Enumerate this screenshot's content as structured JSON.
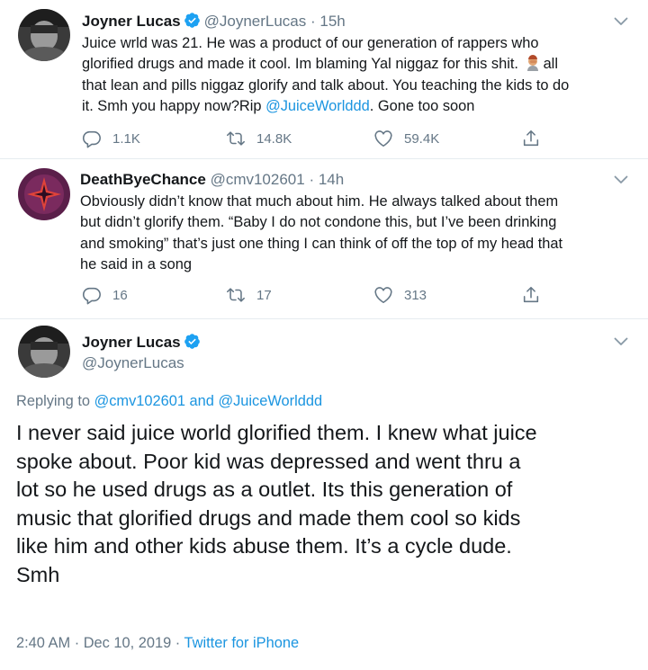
{
  "colors": {
    "link": "#1b95e0",
    "muted": "#657786",
    "text": "#14171a",
    "verified": "#1da1f2"
  },
  "tweet1": {
    "name": "Joyner Lucas",
    "handle": "@JoynerLucas",
    "time": "· 15h",
    "lines": [
      "Juice wrld was 21. He was a product of our generation of rappers who",
      "glorified drugs and made it cool. Im blaming Yal niggaz for this shit.",
      "all",
      "that lean and pills niggaz glorify and talk about. You teaching the kids to do",
      "it. Smh you happy now?Rip",
      "@JuiceWorlddd",
      ". Gone too soon"
    ],
    "emoji": "facepalm-emoji",
    "replies": "1.1K",
    "retweets": "14.8K",
    "likes": "59.4K"
  },
  "tweet2": {
    "name": "DeathByeChance",
    "handle": "@cmv102601",
    "time": "· 14h",
    "lines": [
      "Obviously didn’t know that much about him. He always talked about them",
      "but didn’t glorify them. “Baby I do not condone this, but I’ve been drinking",
      "and smoking” that’s just one thing I can think of off the top of my head that",
      "he said in a song"
    ],
    "replies": "16",
    "retweets": "17",
    "likes": "313"
  },
  "tweet3": {
    "name": "Joyner Lucas",
    "handle": "@JoynerLucas",
    "replying_prefix": "Replying to",
    "replying_user1": "@cmv102601",
    "replying_and": "and",
    "replying_user2": "@JuiceWorlddd",
    "lines": [
      "I never said juice world glorified them. I knew what juice",
      "spoke about. Poor kid was depressed and went thru a",
      "lot so he used drugs as a outlet. Its this generation of",
      "music that glorified drugs and made them cool so kids",
      "like him and other kids abuse them. It’s a cycle dude.",
      "Smh"
    ],
    "time": "2:40 AM",
    "date": "Dec 10, 2019",
    "source": "Twitter for iPhone"
  }
}
